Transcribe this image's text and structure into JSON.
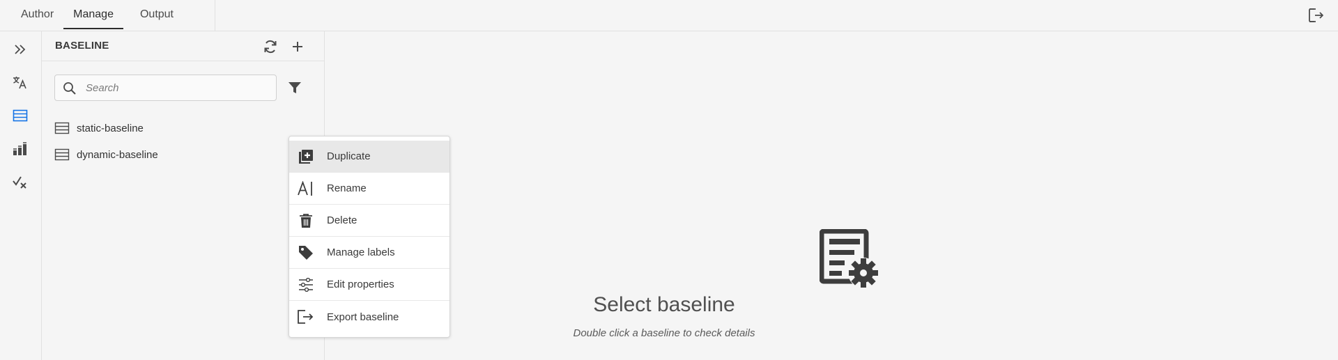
{
  "tabs": [
    {
      "label": "Author"
    },
    {
      "label": "Manage",
      "active": true
    },
    {
      "label": "Output"
    }
  ],
  "rail": {
    "items": [
      "expand-icon",
      "translate-icon",
      "baseline-icon",
      "reports-icon",
      "review-icon"
    ],
    "active_color": "#1473e6"
  },
  "panel": {
    "title": "BASELINE",
    "search": {
      "placeholder": "Search",
      "value": ""
    },
    "items": [
      {
        "label": "static-baseline"
      },
      {
        "label": "dynamic-baseline"
      }
    ]
  },
  "context_menu": {
    "items": [
      {
        "label": "Duplicate",
        "icon": "duplicate-icon"
      },
      {
        "label": "Rename",
        "icon": "rename-icon"
      },
      {
        "label": "Delete",
        "icon": "trash-icon"
      },
      {
        "label": "Manage labels",
        "icon": "tag-icon"
      },
      {
        "label": "Edit properties",
        "icon": "properties-icon"
      },
      {
        "label": "Export baseline",
        "icon": "export-icon"
      }
    ]
  },
  "empty_state": {
    "title": "Select baseline",
    "subtitle": "Double click a baseline to check details"
  }
}
